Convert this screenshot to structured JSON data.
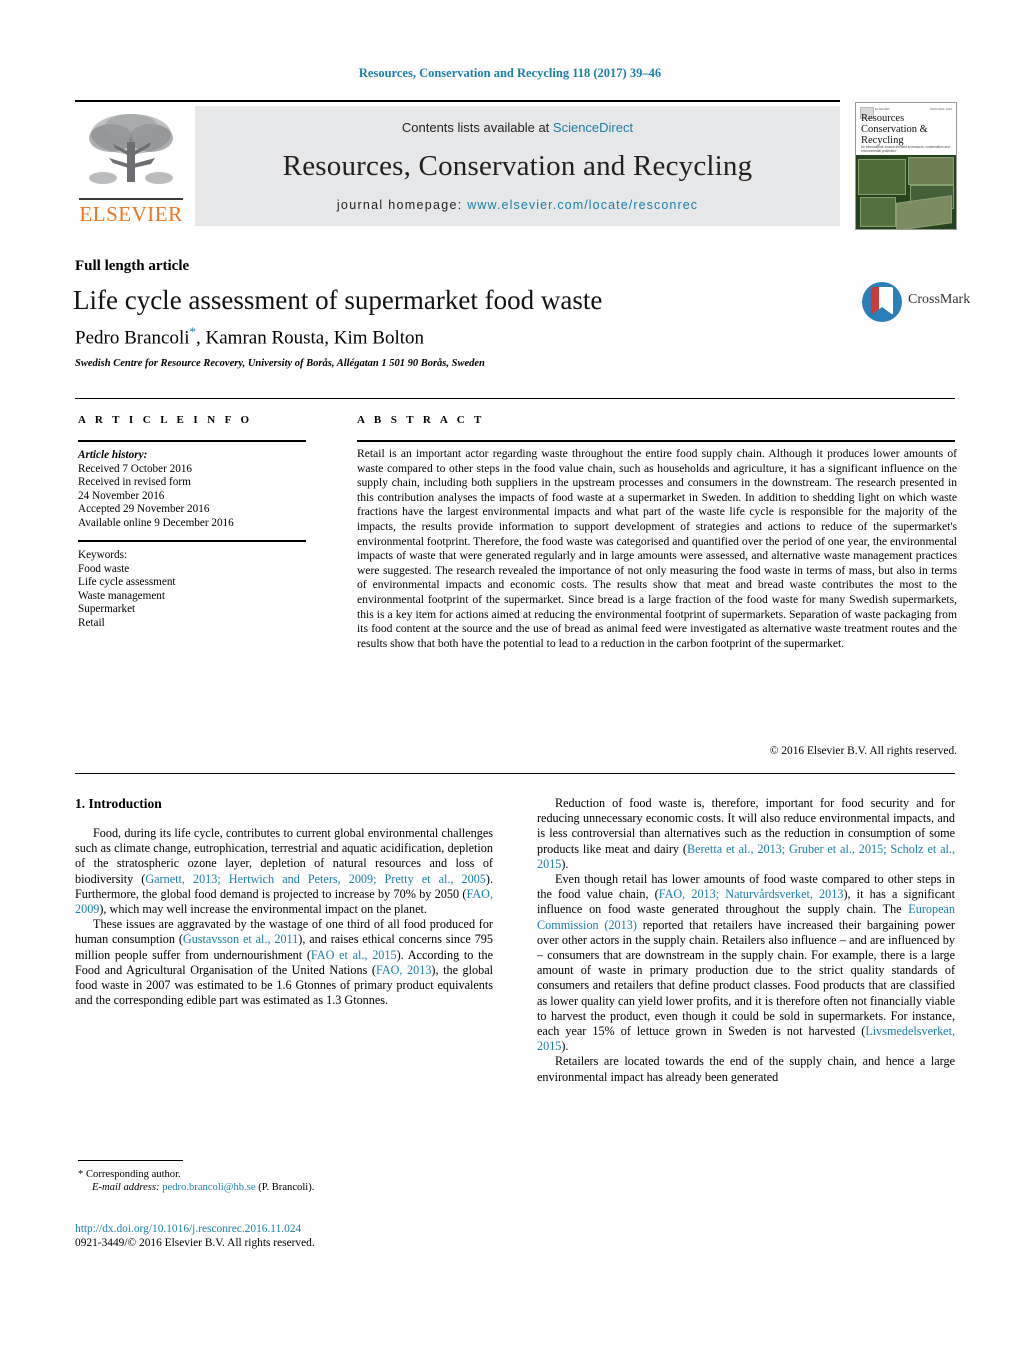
{
  "running_head": "Resources, Conservation and Recycling 118 (2017) 39–46",
  "masthead": {
    "contents_line_prefix": "Contents lists available at ",
    "contents_link": "ScienceDirect",
    "journal_title": "Resources, Conservation and Recycling",
    "homepage_label": "journal homepage:",
    "homepage_url": "www.elsevier.com/locate/resconrec",
    "publisher": "ELSEVIER",
    "cover": {
      "title_line1": "Resources",
      "title_line2": "Conservation &",
      "title_line3": "Recycling",
      "subtitle": "An International Journal devoted to resource, conservation and environmental protection",
      "corner_left": "ELSEVIER",
      "corner_right": "ISSN 0921-3449"
    }
  },
  "article": {
    "kind": "Full length article",
    "title": "Life cycle assessment of supermarket food waste",
    "authors": "Pedro Brancoli",
    "authors_rest": ", Kamran Rousta, Kim Bolton",
    "corresponding_marker": "*",
    "affiliation": "Swedish Centre for Resource Recovery, University of Borås, Allégatan 1 501 90 Borås, Sweden",
    "crossmark_label": "CrossMark"
  },
  "article_info": {
    "heading": "A R T I C L E   I N F O",
    "history_label": "Article history:",
    "history": [
      "Received 7 October 2016",
      "Received in revised form",
      "24 November 2016",
      "Accepted 29 November 2016",
      "Available online 9 December 2016"
    ],
    "keywords_label": "Keywords:",
    "keywords": [
      "Food waste",
      "Life cycle assessment",
      "Waste management",
      "Supermarket",
      "Retail"
    ]
  },
  "abstract": {
    "heading": "A B S T R A C T",
    "text": "Retail is an important actor regarding waste throughout the entire food supply chain. Although it produces lower amounts of waste compared to other steps in the food value chain, such as households and agriculture, it has a significant influence on the supply chain, including both suppliers in the upstream processes and consumers in the downstream. The research presented in this contribution analyses the impacts of food waste at a supermarket in Sweden. In addition to shedding light on which waste fractions have the largest environmental impacts and what part of the waste life cycle is responsible for the majority of the impacts, the results provide information to support development of strategies and actions to reduce of the supermarket's environmental footprint. Therefore, the food waste was categorised and quantified over the period of one year, the environmental impacts of waste that were generated regularly and in large amounts were assessed, and alternative waste management practices were suggested. The research revealed the importance of not only measuring the food waste in terms of mass, but also in terms of environmental impacts and economic costs. The results show that meat and bread waste contributes the most to the environmental footprint of the supermarket. Since bread is a large fraction of the food waste for many Swedish supermarkets, this is a key item for actions aimed at reducing the environmental footprint of supermarkets. Separation of waste packaging from its food content at the source and the use of bread as animal feed were investigated as alternative waste treatment routes and the results show that both have the potential to lead to a reduction in the carbon footprint of the supermarket.",
    "copyright": "© 2016 Elsevier B.V. All rights reserved."
  },
  "body": {
    "section_heading": "1. Introduction",
    "left_paragraphs": [
      {
        "parts": [
          {
            "t": "Food, during its life cycle, contributes to current global environmental challenges such as climate change, eutrophication, terrestrial and aquatic acidification, depletion of the stratospheric ozone layer, depletion of natural resources and loss of biodiversity ("
          },
          {
            "t": "Garnett, 2013; Hertwich and Peters, 2009; Pretty et al., 2005",
            "cite": true
          },
          {
            "t": "). Furthermore, the global food demand is projected to increase by 70% by 2050 ("
          },
          {
            "t": "FAO, 2009",
            "cite": true
          },
          {
            "t": "), which may well increase the environmental impact on the planet."
          }
        ]
      },
      {
        "parts": [
          {
            "t": "These issues are aggravated by the wastage of one third of all food produced for human consumption ("
          },
          {
            "t": "Gustavsson et al., 2011",
            "cite": true
          },
          {
            "t": "), and raises ethical concerns since 795 million people suffer from undernourishment ("
          },
          {
            "t": "FAO et al., 2015",
            "cite": true
          },
          {
            "t": "). According to the Food and Agricultural Organisation of the United Nations ("
          },
          {
            "t": "FAO, 2013",
            "cite": true
          },
          {
            "t": "), the global food waste in 2007 was estimated to be 1.6 Gtonnes of primary product equivalents and the corresponding edible part was estimated as 1.3 Gtonnes."
          }
        ]
      }
    ],
    "right_paragraphs": [
      {
        "parts": [
          {
            "t": "Reduction of food waste is, therefore, important for food security and for reducing unnecessary economic costs. It will also reduce environmental impacts, and is less controversial than alternatives such as the reduction in consumption of some products like meat and dairy ("
          },
          {
            "t": "Beretta et al., 2013; Gruber et al., 2015; Scholz et al., 2015",
            "cite": true
          },
          {
            "t": ")."
          }
        ]
      },
      {
        "parts": [
          {
            "t": "Even though retail has lower amounts of food waste compared to other steps in the food value chain, ("
          },
          {
            "t": "FAO, 2013; Naturvårdsverket, 2013",
            "cite": true
          },
          {
            "t": "), it has a significant influence on food waste generated throughout the supply chain. The "
          },
          {
            "t": "European Commission (2013)",
            "cite": true
          },
          {
            "t": " reported that retailers have increased their bargaining power over other actors in the supply chain. Retailers also influence – and are influenced by – consumers that are downstream in the supply chain. For example, there is a large amount of waste in primary production due to the strict quality standards of consumers and retailers that define product classes. Food products that are classified as lower quality can yield lower profits, and it is therefore often not financially viable to harvest the product, even though it could be sold in supermarkets. For instance, each year 15% of lettuce grown in Sweden is not harvested ("
          },
          {
            "t": "Livsmedelsverket, 2015",
            "cite": true
          },
          {
            "t": ")."
          }
        ]
      },
      {
        "parts": [
          {
            "t": "Retailers are located towards the end of the supply chain, and hence a large environmental impact has already been generated"
          }
        ]
      }
    ]
  },
  "footnotes": {
    "corresponding_marker": "*",
    "corresponding_label": "Corresponding author.",
    "email_label": "E-mail address:",
    "email": "pedro.brancoli@hb.se",
    "email_suffix": "(P. Brancoli).",
    "doi_url": "http://dx.doi.org/10.1016/j.resconrec.2016.11.024",
    "issn_line": "0921-3449/© 2016 Elsevier B.V. All rights reserved."
  },
  "colors": {
    "link": "#1a7fa8",
    "elsevier_orange": "#E87722",
    "banner_bg": "#e6e7e8"
  }
}
